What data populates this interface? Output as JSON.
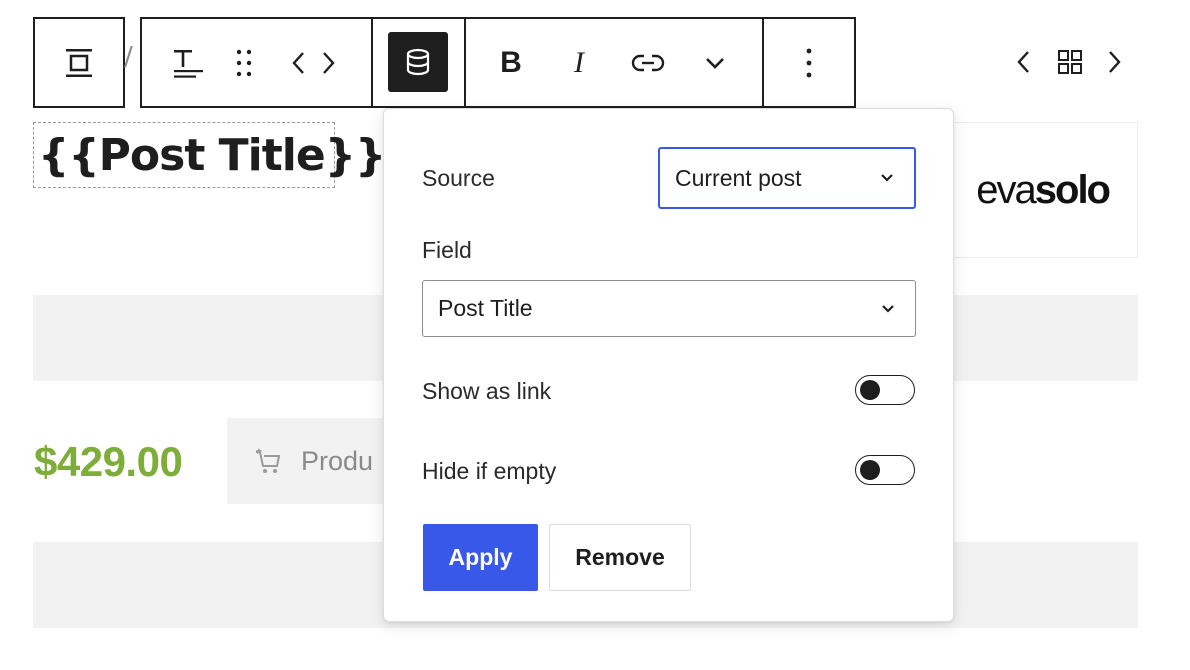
{
  "toolbar": {
    "icons": {
      "block_type": "align-center-icon",
      "text_align": "text-align-icon",
      "drag": "drag-handle-icon",
      "move": "chevron-left-right-icon",
      "data_source": "database-icon",
      "bold": "bold-icon",
      "italic": "italic-icon",
      "link": "link-icon",
      "more_rich_text": "chevron-down-icon",
      "options": "more-vertical-icon"
    },
    "bold_glyph": "B",
    "italic_glyph": "I",
    "separator": "/"
  },
  "navigation": {
    "icons": [
      "chevron-left-icon",
      "grid-icon",
      "chevron-right-icon"
    ]
  },
  "canvas": {
    "post_title": "{{Post Title}}",
    "logo": {
      "light": "eva",
      "heavy": "solo"
    },
    "price": "$429.00",
    "cart_button_label": "Produ"
  },
  "popover": {
    "source_label": "Source",
    "source_value": "Current post",
    "field_label": "Field",
    "field_value": "Post Title",
    "show_as_link_label": "Show as link",
    "hide_if_empty_label": "Hide if empty",
    "apply_label": "Apply",
    "remove_label": "Remove"
  },
  "colors": {
    "accent": "#3858e9",
    "price": "#7fad39",
    "dark": "#1e1e1e"
  }
}
